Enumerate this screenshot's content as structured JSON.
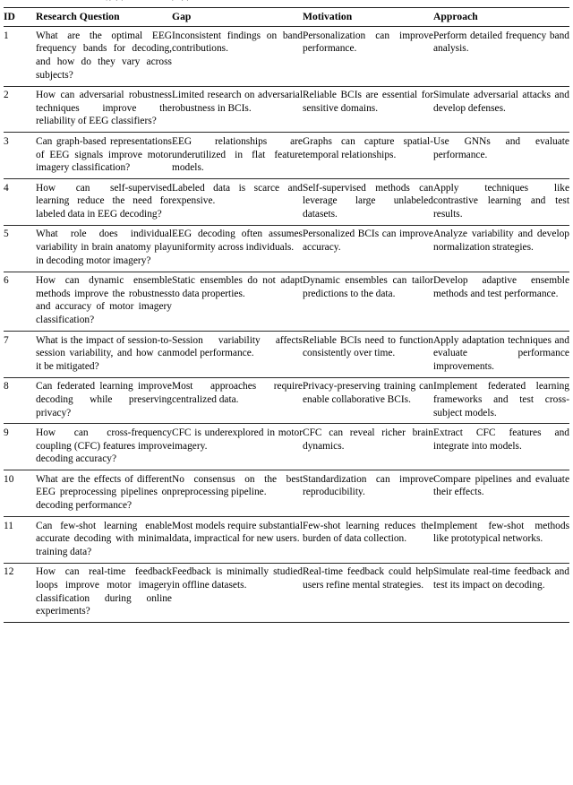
{
  "table": {
    "columns": [
      {
        "key": "id",
        "label": "ID"
      },
      {
        "key": "question",
        "label": "Research Question"
      },
      {
        "key": "gap",
        "label": "Gap"
      },
      {
        "key": "motivation",
        "label": "Motivation"
      },
      {
        "key": "approach",
        "label": "Approach"
      }
    ],
    "rows": [
      {
        "id": "1",
        "question": "What are the optimal EEG frequency bands for decoding, and how do they vary across subjects?",
        "gap": "Inconsistent findings on band contributions.",
        "motivation": "Personalization can improve performance.",
        "approach": "Perform detailed frequency band analysis."
      },
      {
        "id": "2",
        "question": "How can adversarial robustness techniques improve the reliability of EEG classifiers?",
        "gap": "Limited research on adversarial robustness in BCIs.",
        "motivation": "Reliable BCIs are essential for sensitive domains.",
        "approach": "Simulate adversarial attacks and develop defenses."
      },
      {
        "id": "3",
        "question": "Can graph-based representations of EEG signals improve motor imagery classification?",
        "gap": "EEG relationships are underutilized in flat feature models.",
        "motivation": "Graphs can capture spatial-temporal relationships.",
        "approach": "Use GNNs and evaluate performance."
      },
      {
        "id": "4",
        "question": "How can self-supervised learning reduce the need for labeled data in EEG decoding?",
        "gap": "Labeled data is scarce and expensive.",
        "motivation": "Self-supervised methods can leverage large unlabeled datasets.",
        "approach": "Apply techniques like contrastive learning and test results."
      },
      {
        "id": "5",
        "question": "What role does individual variability in brain anatomy play in decoding motor imagery?",
        "gap": "EEG decoding often assumes uniformity across individuals.",
        "motivation": "Personalized BCIs can improve accuracy.",
        "approach": "Analyze variability and develop normalization strategies."
      },
      {
        "id": "6",
        "question": "How can dynamic ensemble methods improve the robustness and accuracy of motor imagery classification?",
        "gap": "Static ensembles do not adapt to data properties.",
        "motivation": "Dynamic ensembles can tailor predictions to the data.",
        "approach": "Develop adaptive ensemble methods and test performance."
      },
      {
        "id": "7",
        "question": "What is the impact of session-to-session variability, and how can it be mitigated?",
        "gap": "Session variability affects model performance.",
        "motivation": "Reliable BCIs need to function consistently over time.",
        "approach": "Apply adaptation techniques and evaluate performance improvements."
      },
      {
        "id": "8",
        "question": "Can federated learning improve decoding while preserving privacy?",
        "gap": "Most approaches require centralized data.",
        "motivation": "Privacy-preserving training can enable collaborative BCIs.",
        "approach": "Implement federated learning frameworks and test cross-subject models."
      },
      {
        "id": "9",
        "question": "How can cross-frequency coupling (CFC) features improve decoding accuracy?",
        "gap": "CFC is underexplored in motor imagery.",
        "motivation": "CFC can reveal richer brain dynamics.",
        "approach": "Extract CFC features and integrate into models."
      },
      {
        "id": "10",
        "question": "What are the effects of different EEG preprocessing pipelines on decoding performance?",
        "gap": "No consensus on the best preprocessing pipeline.",
        "motivation": "Standardization can improve reproducibility.",
        "approach": "Compare pipelines and evaluate their effects."
      },
      {
        "id": "11",
        "question": "Can few-shot learning enable accurate decoding with minimal training data?",
        "gap": "Most models require substantial data, impractical for new users.",
        "motivation": "Few-shot learning reduces the burden of data collection.",
        "approach": "Implement few-shot methods like prototypical networks."
      },
      {
        "id": "12",
        "question": "How can real-time feedback loops improve motor imagery classification during online experiments?",
        "gap": "Feedback is minimally studied in offline datasets.",
        "motivation": "Real-time feedback could help users refine mental strategies.",
        "approach": "Simulate real-time feedback and test its impact on decoding."
      }
    ]
  }
}
